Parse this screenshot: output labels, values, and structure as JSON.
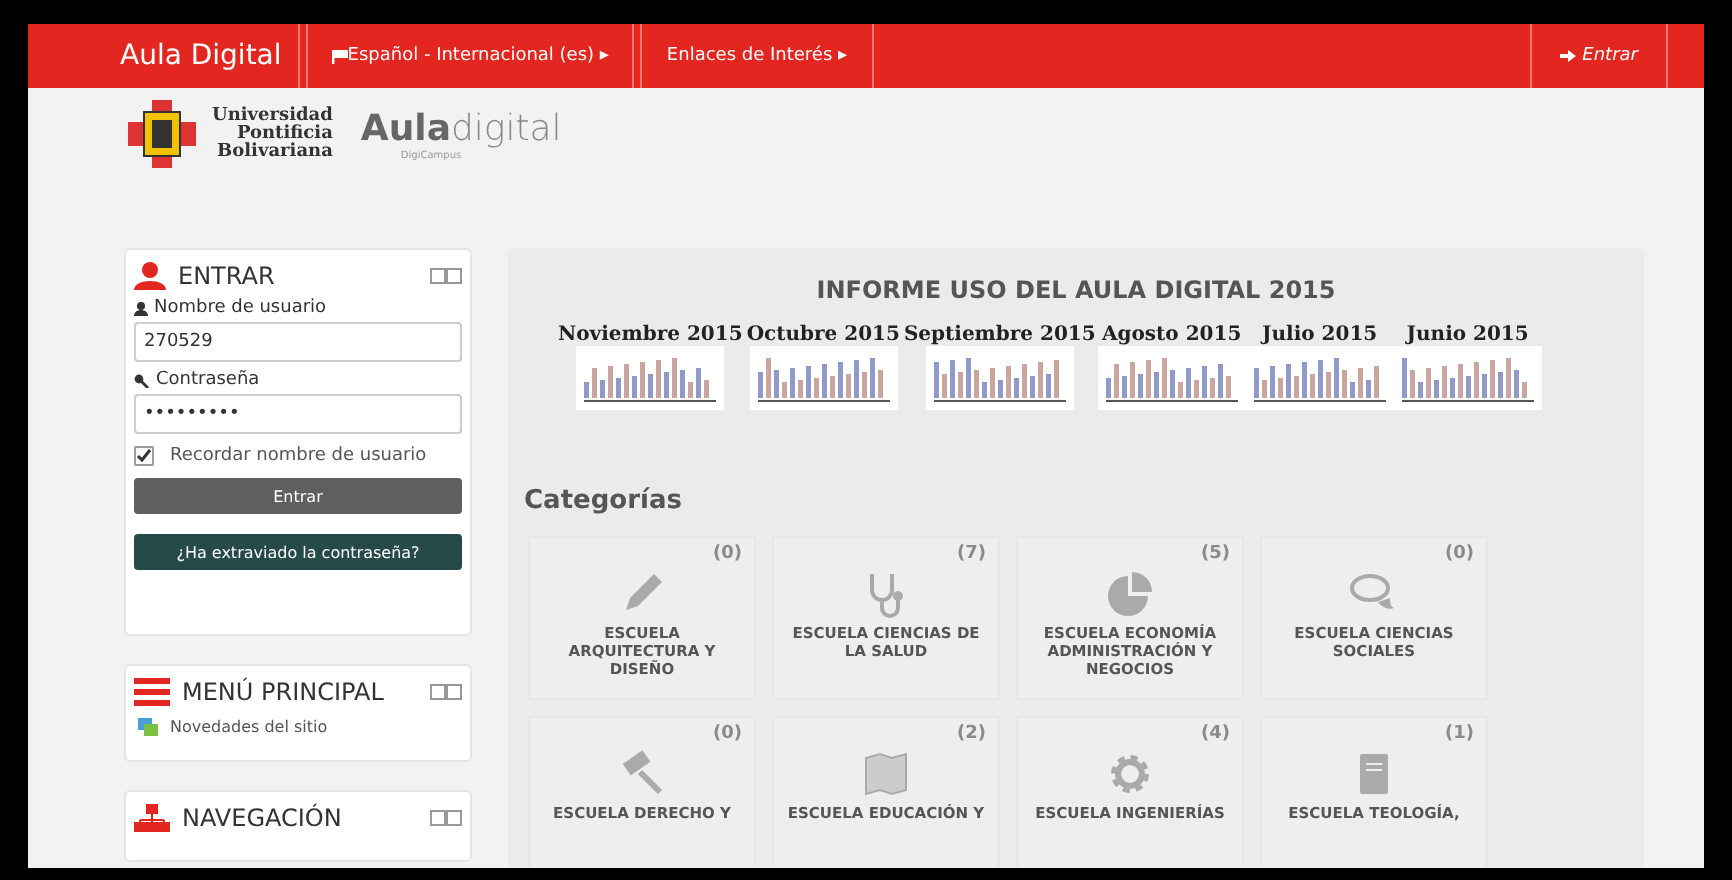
{
  "navbar": {
    "brand": "Aula Digital",
    "menus": [
      {
        "label": "Español - Internacional (es)",
        "caret": "▸"
      },
      {
        "label": "Enlaces de Interés",
        "caret": "▸"
      }
    ],
    "login_link": "Entrar"
  },
  "logo": {
    "university": [
      "Universidad",
      "Pontificia",
      "Bolivariana"
    ],
    "product_bold": "Aula",
    "product_light": "digital",
    "product_sub": "DigiCampus"
  },
  "login_block": {
    "title": "ENTRAR",
    "username_label": "Nombre de usuario",
    "username_value": "270529",
    "password_label": "Contraseña",
    "password_value": "•••••••••",
    "remember_label": "Recordar nombre de usuario",
    "remember_checked": true,
    "submit": "Entrar",
    "forgot": "¿Ha extraviado la contraseña?"
  },
  "main_menu_block": {
    "title": "MENÚ PRINCIPAL",
    "items": [
      "Novedades del sitio"
    ]
  },
  "navigation_block": {
    "title": "NAVEGACIÓN"
  },
  "report": {
    "title": "INFORME USO DEL AULA DIGITAL 2015",
    "months": [
      "Noviembre 2015",
      "Octubre 2015",
      "Septiembre 2015",
      "Agosto 2015",
      "Julio 2015",
      "Junio 2015"
    ]
  },
  "categories": {
    "title": "Categorías",
    "items": [
      {
        "kind": "pencil",
        "count": "(0)",
        "name": "ESCUELA ARQUITECTURA Y DISEÑO"
      },
      {
        "kind": "stethoscope",
        "count": "(7)",
        "name": "ESCUELA CIENCIAS DE LA SALUD"
      },
      {
        "kind": "pie",
        "count": "(5)",
        "name": "ESCUELA ECONOMÍA ADMINISTRACIÓN Y NEGOCIOS"
      },
      {
        "kind": "chat",
        "count": "(0)",
        "name": "ESCUELA CIENCIAS SOCIALES"
      },
      {
        "kind": "gavel",
        "count": "(0)",
        "name": "ESCUELA DERECHO Y"
      },
      {
        "kind": "map",
        "count": "(2)",
        "name": "ESCUELA EDUCACIÓN Y"
      },
      {
        "kind": "gear",
        "count": "(4)",
        "name": "ESCUELA INGENIERÍAS"
      },
      {
        "kind": "book",
        "count": "(1)",
        "name": "ESCUELA TEOLOGÍA,"
      }
    ]
  }
}
